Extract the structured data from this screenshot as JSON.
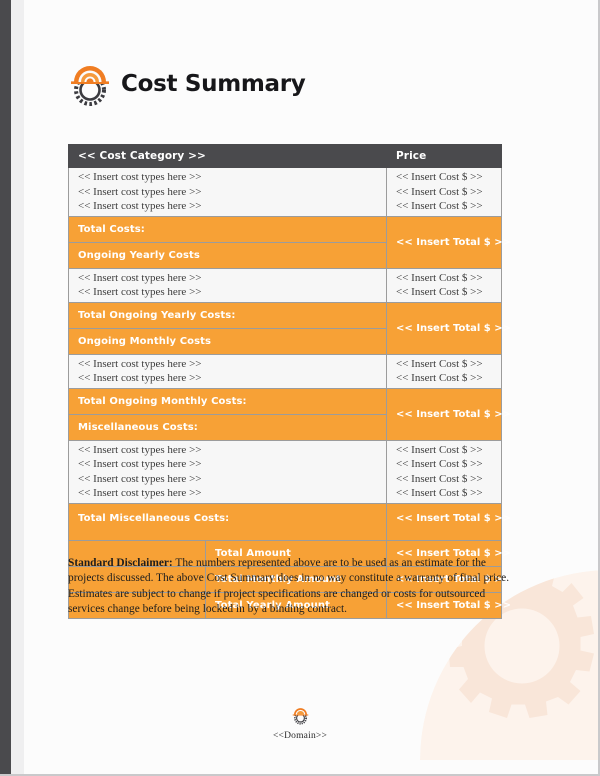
{
  "header": {
    "title": "Cost Summary",
    "logo_icon": "hardhat-gear-logo"
  },
  "table": {
    "columns": {
      "category": "<< Cost Category >>",
      "price": "Price"
    },
    "placeholders": {
      "item": "<< Insert cost types here >>",
      "cost": "<< Insert Cost $ >>",
      "total": "<< Insert Total $ >>"
    },
    "groups": [
      {
        "item_rows": 3,
        "total_label": "Total Costs:",
        "section_label": "Ongoing Yearly Costs"
      },
      {
        "item_rows": 2,
        "total_label": "Total Ongoing Yearly Costs:",
        "section_label": "Ongoing Monthly Costs"
      },
      {
        "item_rows": 2,
        "total_label": "Total Ongoing Monthly Costs:",
        "section_label": "Miscellaneous Costs:"
      },
      {
        "item_rows": 4,
        "total_label": "Total Miscellaneous Costs:",
        "section_label": null
      }
    ],
    "summary_rows": [
      {
        "label": "Total Amount",
        "value": "<< Insert Total $ >>"
      },
      {
        "label": "Total Monthly Amount",
        "value": "<< Insert Total $ >>"
      },
      {
        "label": "Total Yearly Amount",
        "value": "<< Insert Total $ >>"
      }
    ]
  },
  "disclaimer": {
    "heading": "Standard Disclaimer:",
    "body": "The numbers represented above are to be used as an estimate for the projects discussed. The above Cost Summary does in no way constitute a warranty of final price.  Estimates are subject to change if project specifications are changed or costs for outsourced services change before being locked in by a binding contract."
  },
  "footer": {
    "domain": "<<Domain>>",
    "logo_icon": "hardhat-gear-logo-small"
  },
  "colors": {
    "accent_orange": "#f7a136",
    "header_dark": "#4a4a4d",
    "row_light": "#f7f7f7",
    "watermark": "#fbeee6"
  }
}
